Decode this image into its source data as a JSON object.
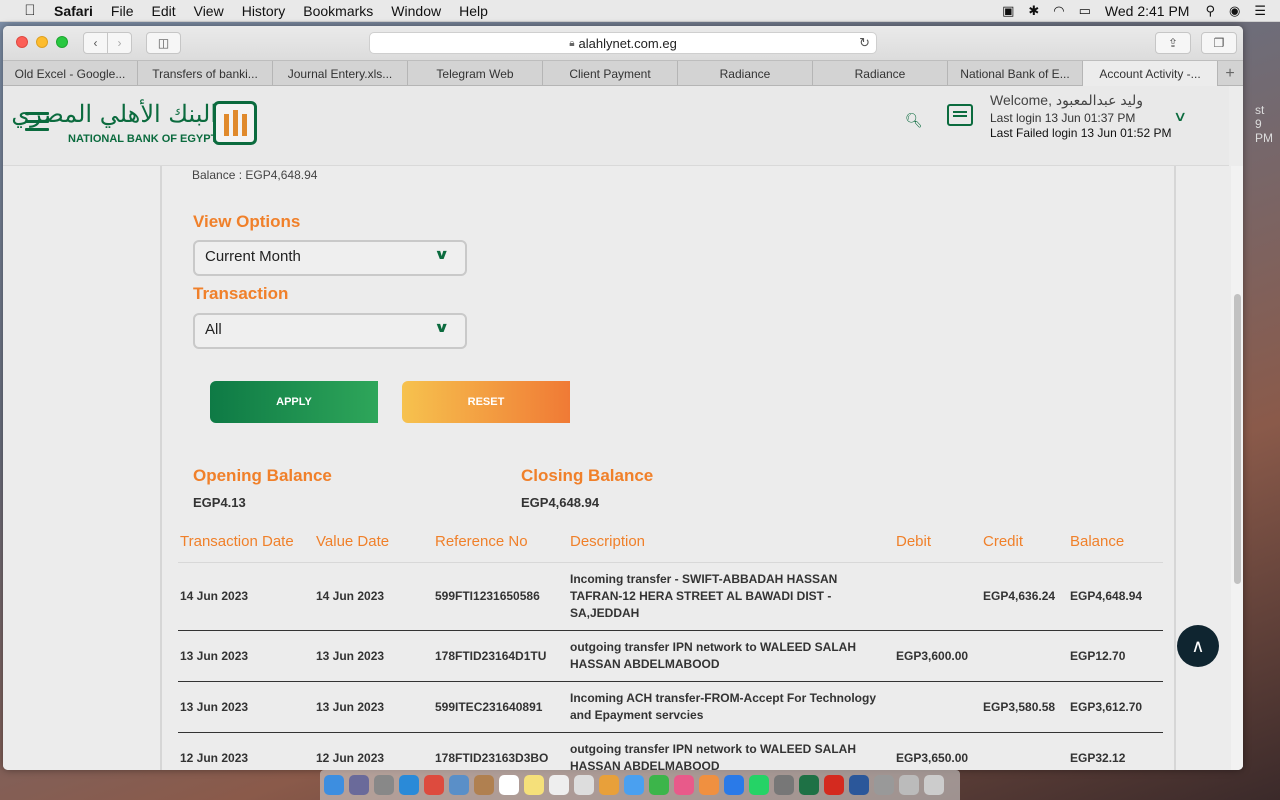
{
  "menubar": {
    "apple_icon": "apple-icon",
    "items": [
      "Safari",
      "File",
      "Edit",
      "View",
      "History",
      "Bookmarks",
      "Window",
      "Help"
    ],
    "status_icons": [
      "keyboard-input-icon",
      "bluetooth-icon",
      "wifi-icon",
      "battery-icon"
    ],
    "clock": "Wed 2:41 PM"
  },
  "browser": {
    "url": "alahlynet.com.eg",
    "tabs": [
      "Old Excel - Google...",
      "Transfers of banki...",
      "Journal Entery.xls...",
      "Telegram Web",
      "Client Payment",
      "Radiance",
      "Radiance",
      "National Bank of E...",
      "Account Activity -..."
    ],
    "new_tab_label": "+"
  },
  "header": {
    "logo_arabic": "البنك الأهلي المصري",
    "logo_english": "NATIONAL BANK OF EGYPT",
    "welcome": "Welcome, وليد عبدالمعبود",
    "last_login": "Last login 13 Jun 01:37 PM",
    "last_failed_login": "Last Failed login 13 Jun 01:52 PM"
  },
  "account": {
    "balance_line": "Balance : EGP4,648.94"
  },
  "filters": {
    "view_options_label": "View Options",
    "view_options_value": "Current Month",
    "transaction_label": "Transaction",
    "transaction_value": "All",
    "apply_label": "APPLY",
    "reset_label": "RESET"
  },
  "balances": {
    "opening_label": "Opening Balance",
    "opening_value": "EGP4.13",
    "closing_label": "Closing Balance",
    "closing_value": "EGP4,648.94"
  },
  "table": {
    "headers": [
      "Transaction Date",
      "Value Date",
      "Reference No",
      "Description",
      "Debit",
      "Credit",
      "Balance"
    ],
    "rows": [
      {
        "transaction_date": "14 Jun 2023",
        "value_date": "14 Jun 2023",
        "reference": "599FTI1231650586",
        "description": "Incoming transfer - SWIFT-ABBADAH HASSAN TAFRAN-12 HERA STREET AL BAWADI DIST - SA,JEDDAH",
        "debit": "",
        "credit": "EGP4,636.24",
        "balance": "EGP4,648.94"
      },
      {
        "transaction_date": "13 Jun 2023",
        "value_date": "13 Jun 2023",
        "reference": "178FTID23164D1TU",
        "description": "outgoing transfer IPN network to WALEED SALAH HASSAN ABDELMABOOD",
        "debit": "EGP3,600.00",
        "credit": "",
        "balance": "EGP12.70"
      },
      {
        "transaction_date": "13 Jun 2023",
        "value_date": "13 Jun 2023",
        "reference": "599ITEC231640891",
        "description": "Incoming ACH transfer-FROM-Accept For Technology and Epayment servcies",
        "debit": "",
        "credit": "EGP3,580.58",
        "balance": "EGP3,612.70"
      },
      {
        "transaction_date": "12 Jun 2023",
        "value_date": "12 Jun 2023",
        "reference": "178FTID23163D3BO",
        "description": "outgoing transfer IPN network to WALEED SALAH HASSAN ABDELMABOOD",
        "debit": "EGP3,650.00",
        "credit": "",
        "balance": "EGP32.12"
      }
    ]
  },
  "desktop_partial_text": [
    "st",
    "9 PM"
  ],
  "colors": {
    "brand_green": "#0b6b3e",
    "accent_orange": "#f0802a"
  }
}
